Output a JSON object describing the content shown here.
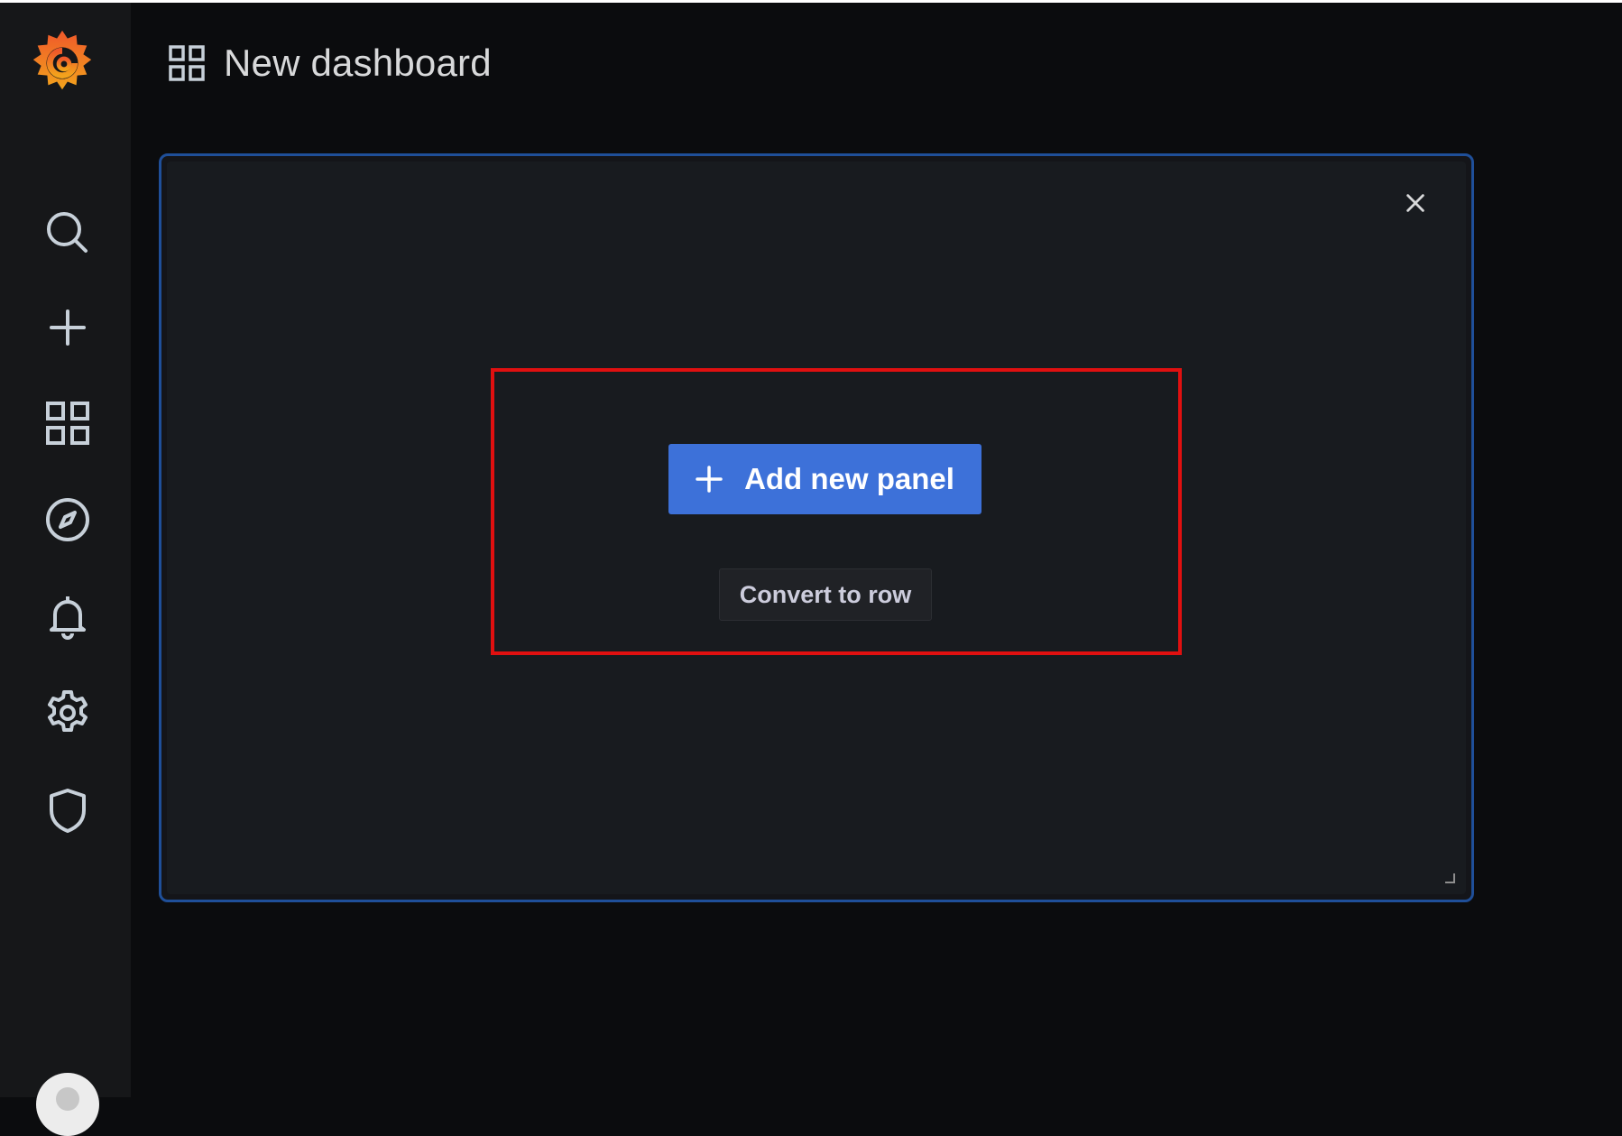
{
  "app": {
    "logo_icon": "grafana-logo-icon"
  },
  "sidebar": {
    "items": [
      {
        "id": "search",
        "icon": "search-icon"
      },
      {
        "id": "create",
        "icon": "plus-icon"
      },
      {
        "id": "dashboards",
        "icon": "dashboards-grid-icon"
      },
      {
        "id": "explore",
        "icon": "compass-icon"
      },
      {
        "id": "alerting",
        "icon": "bell-icon"
      },
      {
        "id": "configuration",
        "icon": "gear-icon"
      },
      {
        "id": "server-admin",
        "icon": "shield-icon"
      }
    ],
    "profile_icon": "user-avatar"
  },
  "header": {
    "icon": "dashboards-grid-icon",
    "title": "New dashboard"
  },
  "panel": {
    "close_icon": "close-icon",
    "add_panel_label": "Add new panel",
    "add_panel_icon": "plus-icon",
    "convert_label": "Convert to row"
  },
  "colors": {
    "primary_button": "#3d71d9",
    "panel_border": "#1f4f99",
    "highlight": "#e01010",
    "background": "#0b0c0e",
    "sidebar": "#161719"
  }
}
